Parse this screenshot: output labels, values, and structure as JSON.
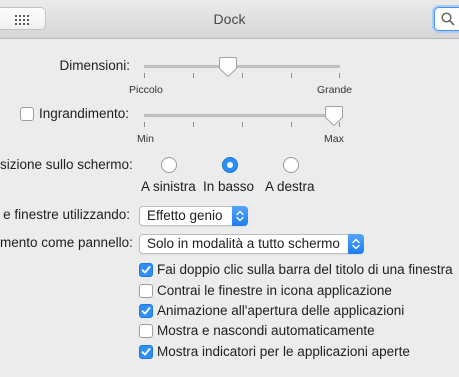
{
  "window": {
    "title": "Dock"
  },
  "colors": {
    "accent": "#2c8ff6",
    "window_bg": "#ececec"
  },
  "icons": {
    "grid": "grid-icon",
    "search": "search-icon"
  },
  "size": {
    "label": "Dimensioni:",
    "min_label": "Piccolo",
    "max_label": "Grande",
    "level": 0.4
  },
  "magnification": {
    "label": "Ingrandimento:",
    "checked": false,
    "min_label": "Min",
    "max_label": "Max",
    "level": 1.0
  },
  "position": {
    "label": "sizione sullo schermo:",
    "options": [
      "A sinistra",
      "In basso",
      "A destra"
    ],
    "selected": "In basso"
  },
  "minimize": {
    "label": "e finestre utilizzando:",
    "value": "Effetto genio"
  },
  "double_click": {
    "label": "mento come pannello:",
    "value": "Solo in modalità a tutto schermo"
  },
  "checkboxes": [
    {
      "label": "Fai doppio clic sulla barra del titolo di una finestra",
      "checked": true
    },
    {
      "label": "Contrai le finestre in icona applicazione",
      "checked": false
    },
    {
      "label": "Animazione all'apertura delle applicazioni",
      "checked": true
    },
    {
      "label": "Mostra e nascondi automaticamente",
      "checked": false
    },
    {
      "label": "Mostra indicatori per le applicazioni aperte",
      "checked": true
    }
  ]
}
